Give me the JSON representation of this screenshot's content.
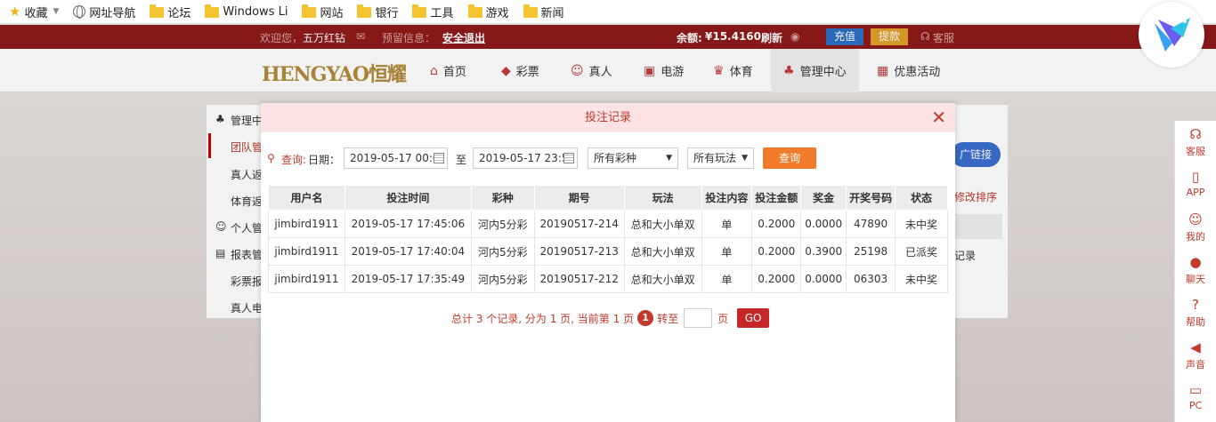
{
  "bookmarks": {
    "items": [
      {
        "label": "收藏",
        "icon": "star-icon"
      },
      {
        "label": "网址导航",
        "icon": "globe-icon"
      },
      {
        "label": "论坛",
        "icon": "folder-icon"
      },
      {
        "label": "Windows Li",
        "icon": "folder-icon"
      },
      {
        "label": "网站",
        "icon": "folder-icon"
      },
      {
        "label": "银行",
        "icon": "folder-icon"
      },
      {
        "label": "工具",
        "icon": "folder-icon"
      },
      {
        "label": "游戏",
        "icon": "folder-icon"
      },
      {
        "label": "新闻",
        "icon": "folder-icon"
      }
    ]
  },
  "topbar": {
    "welcome": "欢迎您，",
    "username": "五万红钻",
    "notice_label": "预留信息：",
    "logout": "安全退出",
    "balance_label": "余额: ",
    "balance": "¥15.4160",
    "refresh": "刷新",
    "recharge": "充值",
    "withdraw": "提款",
    "service": "客服"
  },
  "nav": {
    "logo": "HENGYAO恒耀",
    "items": [
      {
        "label": "首页",
        "icon": "home-icon"
      },
      {
        "label": "彩票",
        "icon": "ticket-icon"
      },
      {
        "label": "真人",
        "icon": "person-icon"
      },
      {
        "label": "电游",
        "icon": "game-icon"
      },
      {
        "label": "体育",
        "icon": "trophy-icon"
      },
      {
        "label": "管理中心",
        "icon": "users-icon"
      },
      {
        "label": "优惠活动",
        "icon": "gift-icon"
      }
    ]
  },
  "sidebar": {
    "items": [
      "管理中",
      "团队管",
      "真人返",
      "体育返",
      "个人管",
      "报表管",
      "彩票报",
      "真人电"
    ]
  },
  "background_right": {
    "link_button": "广链接",
    "sort_link": "修改排序",
    "record": "记录"
  },
  "modal": {
    "title": "投注记录",
    "query_label": "查询:",
    "date_label": "日期：",
    "date_from": "2019-05-17 00:0",
    "to_label": "至",
    "date_to": "2019-05-17 23:5",
    "lottery_select": "所有彩种",
    "play_select": "所有玩法",
    "query_button": "查询",
    "columns": [
      "用户名",
      "投注时间",
      "彩种",
      "期号",
      "玩法",
      "投注内容",
      "投注金额",
      "奖金",
      "开奖号码",
      "状态"
    ],
    "rows": [
      {
        "user": "jimbird1911",
        "time": "2019-05-17 17:45:06",
        "lottery": "河内5分彩",
        "issue": "20190517-214",
        "play": "总和大小单双",
        "content": "单",
        "amount": "0.2000",
        "prize": "0.0000",
        "numbers": "47890",
        "status": "未中奖",
        "status_type": "lose"
      },
      {
        "user": "jimbird1911",
        "time": "2019-05-17 17:40:04",
        "lottery": "河内5分彩",
        "issue": "20190517-213",
        "play": "总和大小单双",
        "content": "单",
        "amount": "0.2000",
        "prize": "0.3900",
        "numbers": "25198",
        "status": "已派奖",
        "status_type": "win"
      },
      {
        "user": "jimbird1911",
        "time": "2019-05-17 17:35:49",
        "lottery": "河内5分彩",
        "issue": "20190517-212",
        "play": "总和大小单双",
        "content": "单",
        "amount": "0.2000",
        "prize": "0.0000",
        "numbers": "06303",
        "status": "未中奖",
        "status_type": "lose"
      }
    ],
    "pager": {
      "summary": "总计 3 个记录, 分为 1 页, 当前第 1 页",
      "current_page": "1",
      "goto_label": "转至",
      "page_unit": "页",
      "go_button": "GO"
    }
  },
  "floatbar": {
    "items": [
      {
        "label": "客服",
        "icon": "headset-icon"
      },
      {
        "label": "APP",
        "icon": "phone-icon"
      },
      {
        "label": "我的",
        "icon": "user-icon"
      },
      {
        "label": "聊天",
        "icon": "chat-icon"
      },
      {
        "label": "帮助",
        "icon": "help-icon"
      },
      {
        "label": "声音",
        "icon": "speaker-icon"
      },
      {
        "label": "PC",
        "icon": "monitor-icon"
      }
    ]
  }
}
